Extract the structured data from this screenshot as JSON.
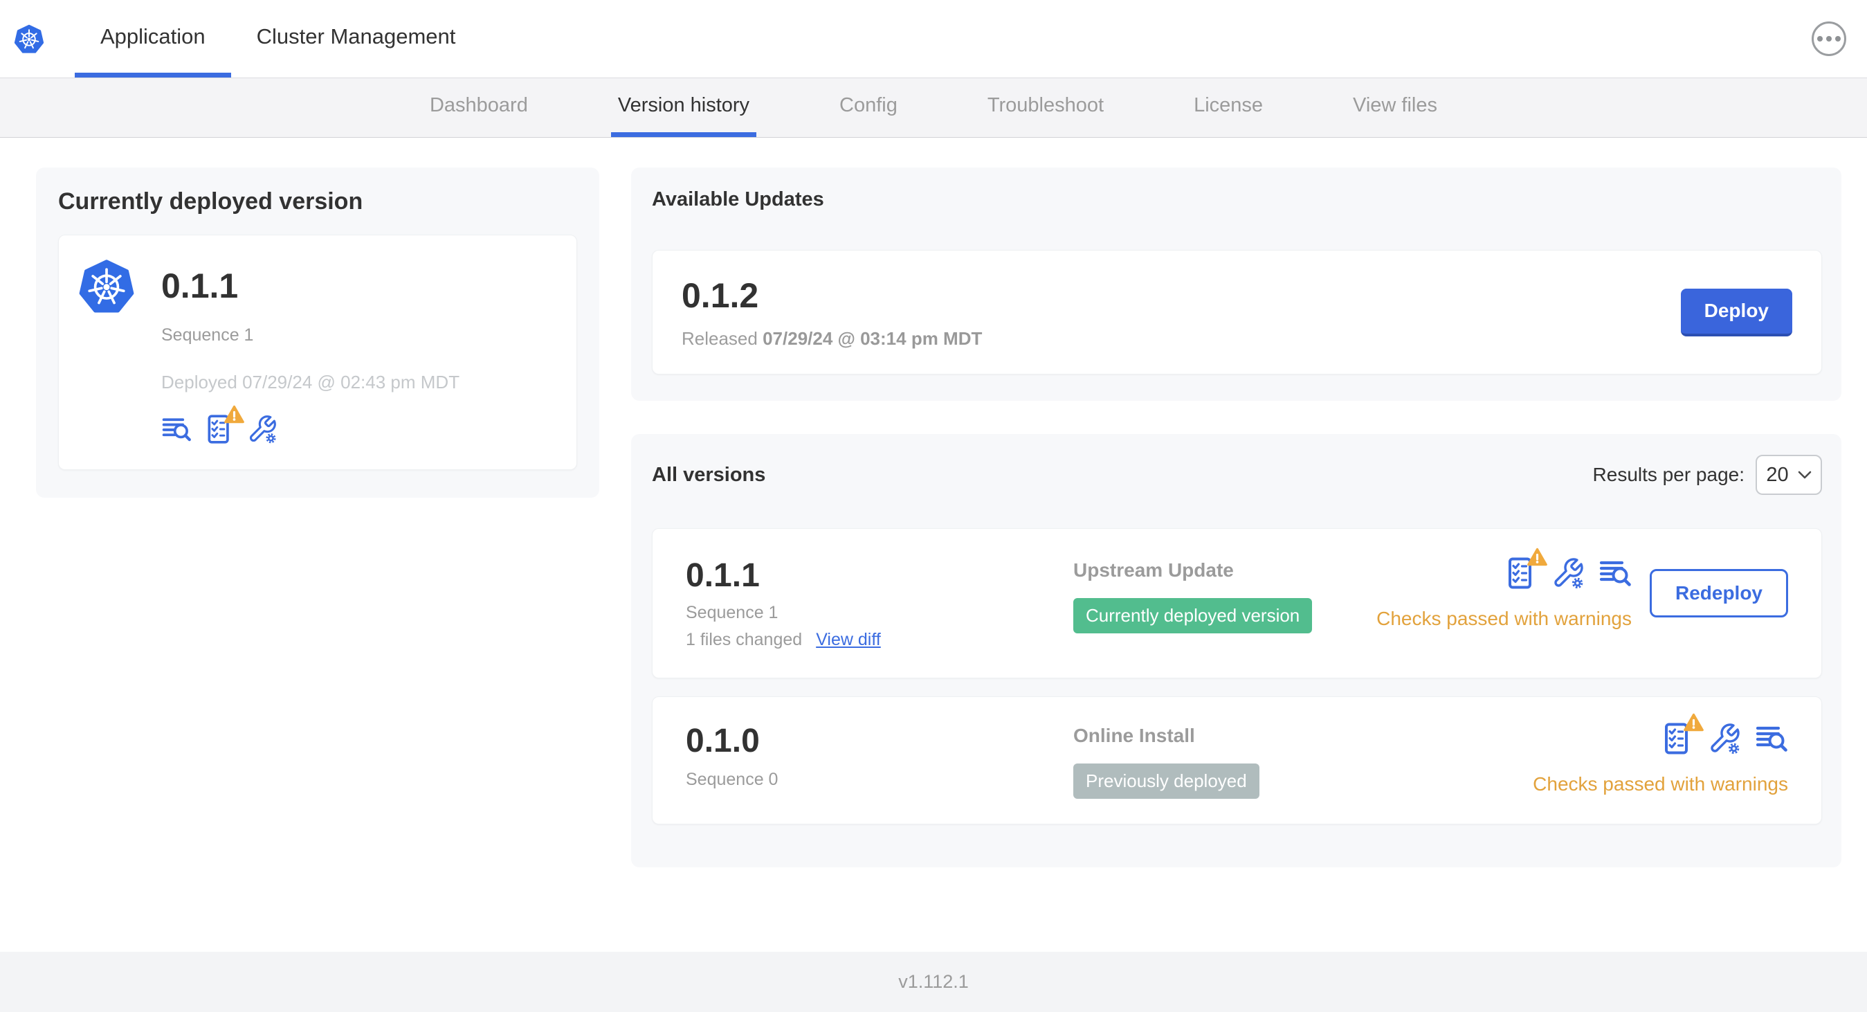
{
  "header": {
    "logo_icon": "kubernetes-logo",
    "tabs": [
      {
        "label": "Application",
        "active": true
      },
      {
        "label": "Cluster Management",
        "active": false
      }
    ],
    "overflow_menu_icon": "ellipsis-icon"
  },
  "subnav": {
    "active_tab": "Version history",
    "tabs": [
      {
        "label": "Dashboard"
      },
      {
        "label": "Version history"
      },
      {
        "label": "Config"
      },
      {
        "label": "Troubleshoot"
      },
      {
        "label": "License"
      },
      {
        "label": "View files"
      }
    ]
  },
  "current_version_card": {
    "title": "Currently deployed version",
    "version": "0.1.1",
    "sequence": "Sequence 1",
    "deployed_timestamp": "Deployed 07/29/24 @ 02:43 pm MDT",
    "icons": [
      "view-logs-icon",
      "preflight-checks-warning-icon",
      "edit-config-icon"
    ]
  },
  "available_updates_card": {
    "title": "Available Updates",
    "update": {
      "version": "0.1.2",
      "released_label": "Released",
      "released_timestamp": "07/29/24 @ 03:14 pm MDT",
      "deploy_button_label": "Deploy"
    }
  },
  "all_versions_card": {
    "title": "All versions",
    "results_per_page_label": "Results per page:",
    "results_per_page_value": "20",
    "rows": [
      {
        "version": "0.1.1",
        "sequence": "Sequence 1",
        "files_changed": "1 files changed",
        "view_diff_label": "View diff",
        "source": "Upstream Update",
        "status_badge": "Currently deployed version",
        "badge_color": "#52bd8e",
        "checks_status": "Checks passed with warnings",
        "action_button_label": "Redeploy",
        "icons": [
          "preflight-checks-warning-icon",
          "edit-config-icon",
          "view-logs-icon"
        ]
      },
      {
        "version": "0.1.0",
        "sequence": "Sequence 0",
        "source": "Online Install",
        "status_badge": "Previously deployed",
        "badge_color": "#b0bcbd",
        "checks_status": "Checks passed with warnings",
        "icons": [
          "preflight-checks-warning-icon",
          "edit-config-icon",
          "view-logs-icon"
        ]
      }
    ]
  },
  "footer": {
    "app_version": "v1.112.1"
  },
  "colors": {
    "accent_blue": "#3b6ce0",
    "kubernetes_blue": "#326ce5",
    "success_green": "#52bd8e",
    "neutral_badge_gray": "#b0bcbd",
    "warning_amber": "#e2a23c"
  }
}
